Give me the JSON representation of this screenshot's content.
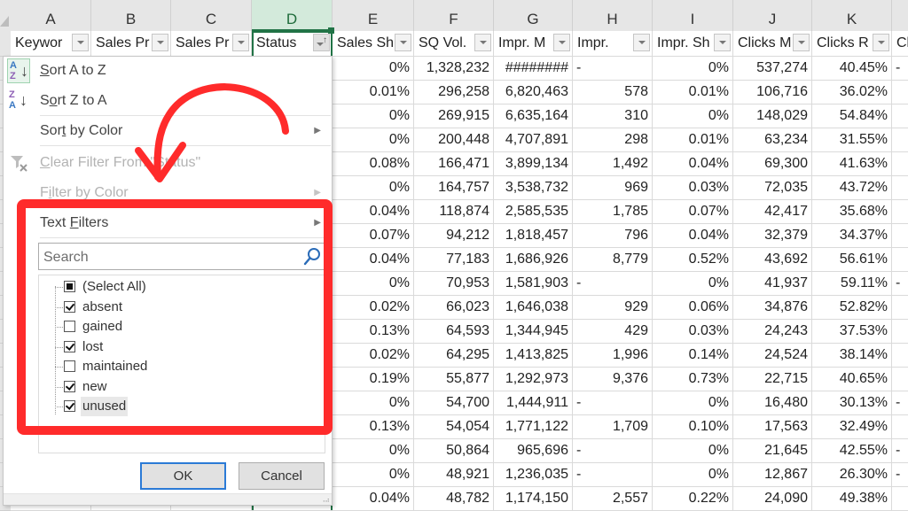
{
  "spreadsheet": {
    "column_letters": [
      "A",
      "B",
      "C",
      "D",
      "E",
      "F",
      "G",
      "H",
      "I",
      "J",
      "K"
    ],
    "selected_column": "D",
    "header_cells": [
      {
        "col": "A",
        "label": "Keywor"
      },
      {
        "col": "B",
        "label": "Sales Pr"
      },
      {
        "col": "C",
        "label": "Sales Pr"
      },
      {
        "col": "D",
        "label": "Status"
      },
      {
        "col": "E",
        "label": "Sales Sh"
      },
      {
        "col": "F",
        "label": "SQ Vol."
      },
      {
        "col": "G",
        "label": "Impr. M"
      },
      {
        "col": "H",
        "label": "Impr."
      },
      {
        "col": "I",
        "label": "Impr. Sh"
      },
      {
        "col": "J",
        "label": "Clicks M"
      },
      {
        "col": "K",
        "label": "Clicks R"
      },
      {
        "col": "L",
        "label": "Cl"
      }
    ],
    "rows": [
      {
        "E": "0%",
        "F": "1,328,232",
        "G": "########",
        "H": "-",
        "I": "0%",
        "J": "537,274",
        "K": "40.45%",
        "L": "-"
      },
      {
        "E": "0.01%",
        "F": "296,258",
        "G": "6,820,463",
        "H": "578",
        "I": "0.01%",
        "J": "106,716",
        "K": "36.02%",
        "L": ""
      },
      {
        "E": "0%",
        "F": "269,915",
        "G": "6,635,164",
        "H": "310",
        "I": "0%",
        "J": "148,029",
        "K": "54.84%",
        "L": ""
      },
      {
        "E": "0%",
        "F": "200,448",
        "G": "4,707,891",
        "H": "298",
        "I": "0.01%",
        "J": "63,234",
        "K": "31.55%",
        "L": ""
      },
      {
        "E": "0.08%",
        "F": "166,471",
        "G": "3,899,134",
        "H": "1,492",
        "I": "0.04%",
        "J": "69,300",
        "K": "41.63%",
        "L": ""
      },
      {
        "E": "0%",
        "F": "164,757",
        "G": "3,538,732",
        "H": "969",
        "I": "0.03%",
        "J": "72,035",
        "K": "43.72%",
        "L": ""
      },
      {
        "E": "0.04%",
        "F": "118,874",
        "G": "2,585,535",
        "H": "1,785",
        "I": "0.07%",
        "J": "42,417",
        "K": "35.68%",
        "L": ""
      },
      {
        "E": "0.07%",
        "F": "94,212",
        "G": "1,818,457",
        "H": "796",
        "I": "0.04%",
        "J": "32,379",
        "K": "34.37%",
        "L": ""
      },
      {
        "E": "0.04%",
        "F": "77,183",
        "G": "1,686,926",
        "H": "8,779",
        "I": "0.52%",
        "J": "43,692",
        "K": "56.61%",
        "L": ""
      },
      {
        "E": "0%",
        "F": "70,953",
        "G": "1,581,903",
        "H": "-",
        "I": "0%",
        "J": "41,937",
        "K": "59.11%",
        "L": "-"
      },
      {
        "E": "0.02%",
        "F": "66,023",
        "G": "1,646,038",
        "H": "929",
        "I": "0.06%",
        "J": "34,876",
        "K": "52.82%",
        "L": ""
      },
      {
        "E": "0.13%",
        "F": "64,593",
        "G": "1,344,945",
        "H": "429",
        "I": "0.03%",
        "J": "24,243",
        "K": "37.53%",
        "L": ""
      },
      {
        "E": "0.02%",
        "F": "64,295",
        "G": "1,413,825",
        "H": "1,996",
        "I": "0.14%",
        "J": "24,524",
        "K": "38.14%",
        "L": ""
      },
      {
        "E": "0.19%",
        "F": "55,877",
        "G": "1,292,973",
        "H": "9,376",
        "I": "0.73%",
        "J": "22,715",
        "K": "40.65%",
        "L": ""
      },
      {
        "E": "0%",
        "F": "54,700",
        "G": "1,444,911",
        "H": "-",
        "I": "0%",
        "J": "16,480",
        "K": "30.13%",
        "L": "-"
      },
      {
        "E": "0.13%",
        "F": "54,054",
        "G": "1,771,122",
        "H": "1,709",
        "I": "0.10%",
        "J": "17,563",
        "K": "32.49%",
        "L": ""
      },
      {
        "E": "0%",
        "F": "50,864",
        "G": "965,696",
        "H": "-",
        "I": "0%",
        "J": "21,645",
        "K": "42.55%",
        "L": "-"
      },
      {
        "E": "0%",
        "F": "48,921",
        "G": "1,236,035",
        "H": "-",
        "I": "0%",
        "J": "12,867",
        "K": "26.30%",
        "L": "-"
      },
      {
        "E": "0.04%",
        "F": "48,782",
        "G": "1,174,150",
        "H": "2,557",
        "I": "0.22%",
        "J": "24,090",
        "K": "49.38%",
        "L": ""
      }
    ]
  },
  "filter_menu": {
    "items": [
      {
        "id": "sort-a-z",
        "pre": "",
        "ul": "S",
        "post": "ort A to Z",
        "enabled": true,
        "submenu": false,
        "icon": "sort-a-to-z-icon"
      },
      {
        "id": "sort-z-a",
        "pre": "S",
        "ul": "o",
        "post": "rt Z to A",
        "enabled": true,
        "submenu": false,
        "icon": "sort-z-to-a-icon"
      },
      {
        "id": "sort-by-color",
        "pre": "Sor",
        "ul": "t",
        "post": " by Color",
        "enabled": true,
        "submenu": true,
        "icon": ""
      },
      {
        "id": "clear-filter",
        "pre": "",
        "ul": "C",
        "post": "lear Filter From \"Status\"",
        "enabled": false,
        "submenu": false,
        "icon": "clear-filter-icon"
      },
      {
        "id": "filter-by-color",
        "pre": "F",
        "ul": "i",
        "post": "lter by Color",
        "enabled": false,
        "submenu": true,
        "icon": ""
      },
      {
        "id": "text-filters",
        "pre": "Text ",
        "ul": "F",
        "post": "ilters",
        "enabled": true,
        "submenu": true,
        "icon": ""
      }
    ],
    "search_placeholder": "Search",
    "values": [
      {
        "label": "(Select All)",
        "state": "partial"
      },
      {
        "label": "absent",
        "state": "checked"
      },
      {
        "label": "gained",
        "state": "unchecked"
      },
      {
        "label": "lost",
        "state": "checked"
      },
      {
        "label": "maintained",
        "state": "unchecked"
      },
      {
        "label": "new",
        "state": "checked"
      },
      {
        "label": "unused",
        "state": "checked"
      }
    ],
    "ok_label": "OK",
    "cancel_label": "Cancel"
  },
  "annotation": {
    "color": "#ff2b2b",
    "shapes": [
      "curved-arrow",
      "highlight-rectangle"
    ],
    "highlights": "Text Filters and value checklist"
  },
  "colors": {
    "excel_green": "#217346",
    "selected_header_bg": "#d3eadb",
    "ok_focus_border": "#2b7ad6"
  }
}
